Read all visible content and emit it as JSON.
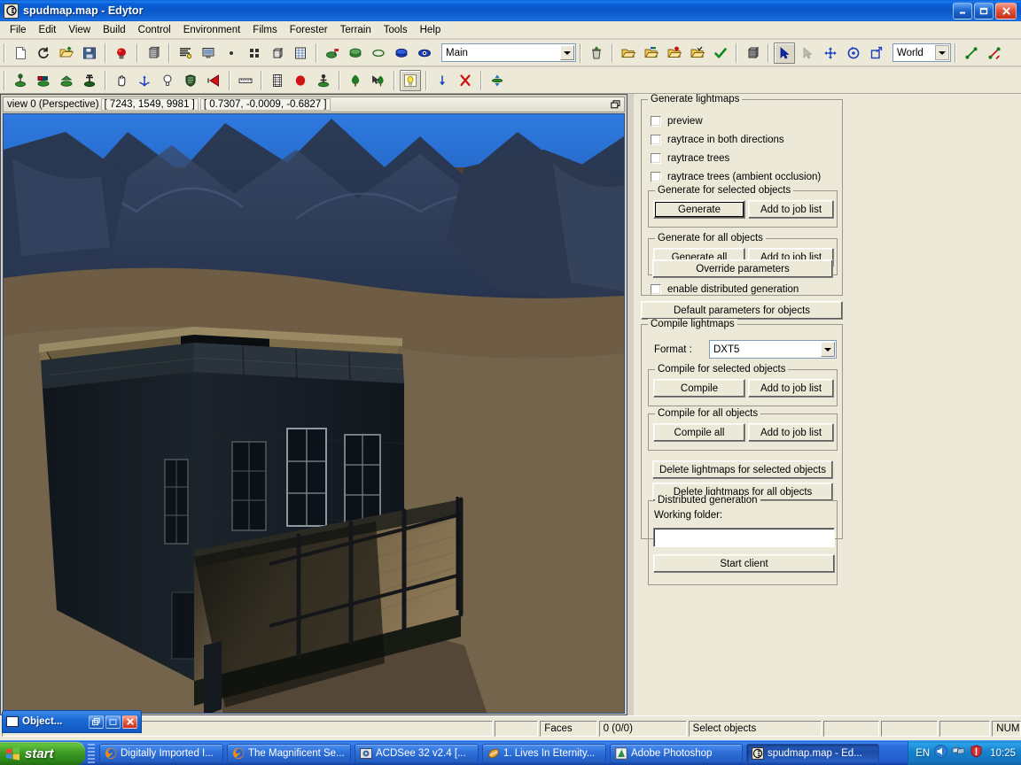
{
  "window": {
    "title": "spudmap.map - Edytor",
    "app_icon": "edytor-icon",
    "minimize_label": "_",
    "maximize_label": "❐",
    "close_label": "✕"
  },
  "menubar": {
    "items": [
      {
        "label": "File"
      },
      {
        "label": "Edit"
      },
      {
        "label": "View"
      },
      {
        "label": "Build"
      },
      {
        "label": "Control"
      },
      {
        "label": "Environment"
      },
      {
        "label": "Films"
      },
      {
        "label": "Forester"
      },
      {
        "label": "Terrain"
      },
      {
        "label": "Tools"
      },
      {
        "label": "Help"
      }
    ]
  },
  "toolbar1": {
    "layer_combo_value": "Main",
    "space_combo_value": "World",
    "buttons": [
      {
        "name": "new-file-icon"
      },
      {
        "name": "reload-icon"
      },
      {
        "name": "open-folder-icon"
      },
      {
        "name": "save-icon"
      },
      {
        "name": "lightbulb-red-icon"
      },
      {
        "name": "cube-texture-icon"
      },
      {
        "name": "list-properties-icon"
      },
      {
        "name": "monitor-icon"
      },
      {
        "name": "small-dot-icon"
      },
      {
        "name": "grid-four-icon"
      },
      {
        "name": "box-icon"
      },
      {
        "name": "spreadsheet-icon"
      },
      {
        "name": "flag-layer-icon"
      },
      {
        "name": "layer-hide-icon"
      },
      {
        "name": "layer-outline-icon"
      },
      {
        "name": "layer-blue-icon"
      },
      {
        "name": "eye-blue-icon"
      },
      {
        "name": "trash-icon"
      },
      {
        "name": "folder-open-icon"
      },
      {
        "name": "folder-flag-icon"
      },
      {
        "name": "folder-red-icon"
      },
      {
        "name": "folder-check-icon"
      },
      {
        "name": "checkmark-icon"
      },
      {
        "name": "cube-grid-icon"
      },
      {
        "name": "select-arrow-icon"
      },
      {
        "name": "select-arrow-disabled-icon"
      },
      {
        "name": "move-icon"
      },
      {
        "name": "rotate-icon"
      },
      {
        "name": "scale-icon"
      },
      {
        "name": "link-green-icon"
      },
      {
        "name": "unlink-red-icon"
      }
    ]
  },
  "toolbar2": {
    "buttons": [
      {
        "name": "place-object-icon"
      },
      {
        "name": "place-object-multi-icon"
      },
      {
        "name": "place-object-alt-icon"
      },
      {
        "name": "place-object-dark-icon"
      },
      {
        "name": "pan-hand-icon"
      },
      {
        "name": "axis-gizmo-icon"
      },
      {
        "name": "lightbulb-icon"
      },
      {
        "name": "shield-icon"
      },
      {
        "name": "sound-cone-icon"
      },
      {
        "name": "ruler-icon"
      },
      {
        "name": "film-strip-icon"
      },
      {
        "name": "record-red-icon"
      },
      {
        "name": "actor-icon"
      },
      {
        "name": "tree-icon"
      },
      {
        "name": "tree-select-icon"
      },
      {
        "name": "light-panel-icon"
      },
      {
        "name": "drop-down-icon"
      },
      {
        "name": "delete-red-x-icon"
      },
      {
        "name": "vertical-align-icon"
      }
    ]
  },
  "viewport": {
    "title_label": "view 0 (Perspective)",
    "position": "[    7243,    1549,    9981 ]",
    "direction": "[ 0.7307, -0.0009, -0.6827 ]",
    "restore_icon": "restore-window-icon"
  },
  "panel": {
    "generate_lightmaps": {
      "legend": "Generate lightmaps",
      "checkboxes": [
        {
          "label": "preview",
          "checked": false
        },
        {
          "label": "raytrace in both directions",
          "checked": false
        },
        {
          "label": "raytrace trees",
          "checked": false
        },
        {
          "label": "raytrace trees (ambient occlusion)",
          "checked": false
        }
      ],
      "generate_selected": {
        "legend": "Generate for selected objects",
        "primary": "Generate",
        "secondary": "Add to job list"
      },
      "generate_all": {
        "legend": "Generate for all objects",
        "primary": "Generate all",
        "secondary": "Add to job list"
      },
      "override_parameters": "Override parameters",
      "enable_distributed": {
        "label": "enable distributed generation",
        "checked": false
      }
    },
    "default_parameters_button": "Default parameters for objects",
    "compile_lightmaps": {
      "legend": "Compile lightmaps",
      "format_label": "Format :",
      "format_value": "DXT5",
      "compile_selected": {
        "legend": "Compile for selected objects",
        "primary": "Compile",
        "secondary": "Add to job list"
      },
      "compile_all": {
        "legend": "Compile for all objects",
        "primary": "Compile all",
        "secondary": "Add to job list"
      }
    },
    "delete_selected_button": "Delete lightmaps for selected objects",
    "delete_all_button": "Delete lightmaps for all objects",
    "distributed_generation": {
      "legend": "Distributed generation",
      "working_folder_label": "Working folder:",
      "working_folder_value": "",
      "start_client_button": "Start client"
    }
  },
  "mdi_child": {
    "title": "Object...",
    "restore_label": "❐",
    "maximize_label": "▭",
    "close_label": "✕"
  },
  "statusbar": {
    "panes": [
      {
        "text": ""
      },
      {
        "text": ""
      },
      {
        "text": "Faces"
      },
      {
        "text": "0  (0/0)"
      },
      {
        "text": "Select objects"
      },
      {
        "text": ""
      },
      {
        "text": ""
      },
      {
        "text": ""
      },
      {
        "text": "NUM"
      }
    ]
  },
  "taskbar": {
    "start_label": "start",
    "items": [
      {
        "label": "Digitally Imported I...",
        "icon": "firefox-icon",
        "active": false
      },
      {
        "label": "The Magnificent Se...",
        "icon": "firefox-icon",
        "active": false
      },
      {
        "label": "ACDSee 32 v2.4 [...",
        "icon": "acdsee-icon",
        "active": false
      },
      {
        "label": "1. Lives In Eternity...",
        "icon": "winamp-icon",
        "active": false
      },
      {
        "label": "Adobe Photoshop",
        "icon": "photoshop-icon",
        "active": false
      },
      {
        "label": "spudmap.map - Ed...",
        "icon": "edytor-icon",
        "active": true
      }
    ],
    "tray": {
      "language": "EN",
      "icons": [
        "volume-icon",
        "network-icon",
        "security-shield-icon"
      ],
      "clock": "10:25"
    }
  },
  "colors": {
    "title_blue": "#0a57c8",
    "face_gray": "#ece9d8",
    "accent_green": "#3f9c25",
    "viewport_sky": "#2a6fd0",
    "viewport_ground": "#6b5a45"
  }
}
